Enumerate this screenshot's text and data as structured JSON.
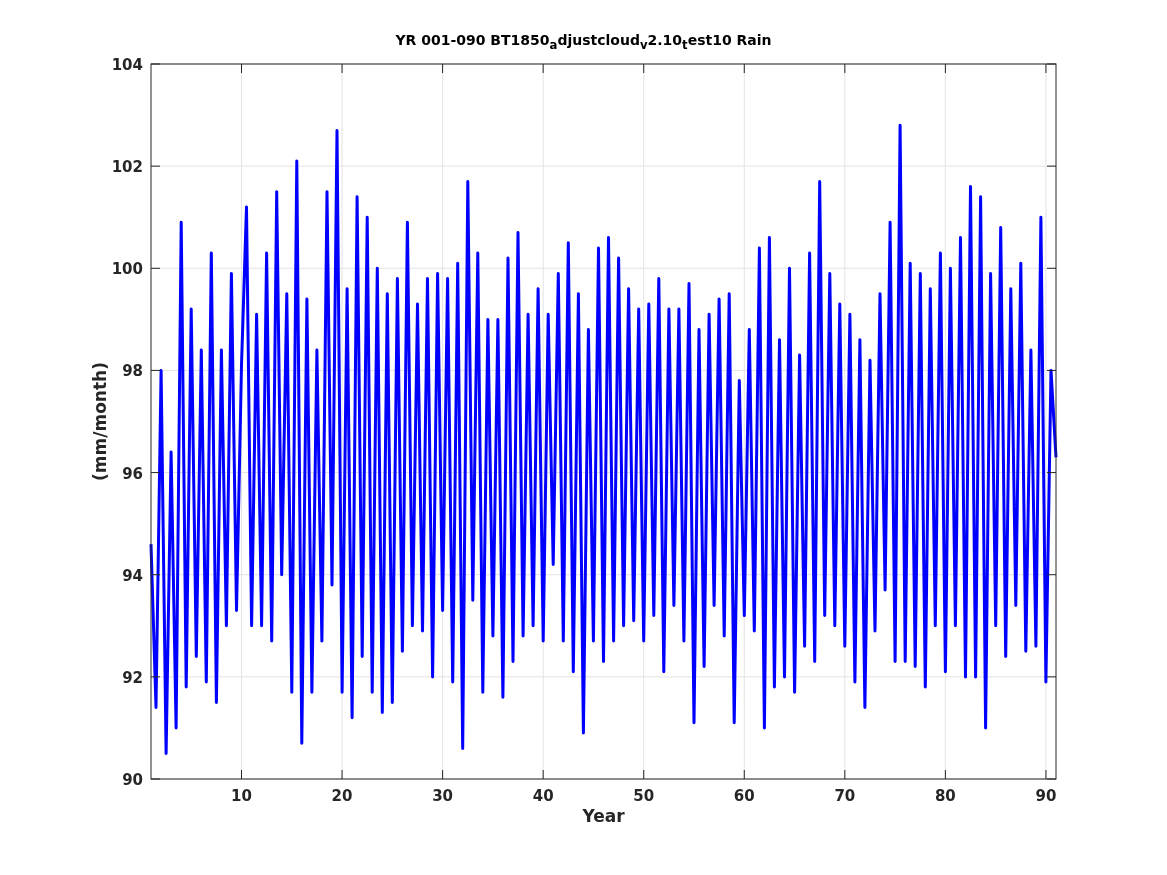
{
  "figure": {
    "chart_data": {
      "type": "line",
      "title": "YR 001-090 BT1850$_{a}$djustcloud$_{v}$2.10$_{t}$est10 Rain",
      "xlabel": "Year",
      "ylabel": "(mm/month)",
      "xlim": [
        1,
        91
      ],
      "ylim": [
        90,
        104
      ],
      "grid": true,
      "xticks": [
        10,
        20,
        30,
        40,
        50,
        60,
        70,
        80,
        90
      ],
      "yticks": [
        90,
        92,
        94,
        96,
        98,
        100,
        102,
        104
      ],
      "x": [
        1,
        1.5,
        2,
        2.5,
        3,
        3.5,
        4,
        4.5,
        5,
        5.5,
        6,
        6.5,
        7,
        7.5,
        8,
        8.5,
        9,
        9.5,
        10,
        10.5,
        11,
        11.5,
        12,
        12.5,
        13,
        13.5,
        14,
        14.5,
        15,
        15.5,
        16,
        16.5,
        17,
        17.5,
        18,
        18.5,
        19,
        19.5,
        20,
        20.5,
        21,
        21.5,
        22,
        22.5,
        23,
        23.5,
        24,
        24.5,
        25,
        25.5,
        26,
        26.5,
        27,
        27.5,
        28,
        28.5,
        29,
        29.5,
        30,
        30.5,
        31,
        31.5,
        32,
        32.5,
        33,
        33.5,
        34,
        34.5,
        35,
        35.5,
        36,
        36.5,
        37,
        37.5,
        38,
        38.5,
        39,
        39.5,
        40,
        40.5,
        41,
        41.5,
        42,
        42.5,
        43,
        43.5,
        44,
        44.5,
        45,
        45.5,
        46,
        46.5,
        47,
        47.5,
        48,
        48.5,
        49,
        49.5,
        50,
        50.5,
        51,
        51.5,
        52,
        52.5,
        53,
        53.5,
        54,
        54.5,
        55,
        55.5,
        56,
        56.5,
        57,
        57.5,
        58,
        58.5,
        59,
        59.5,
        60,
        60.5,
        61,
        61.5,
        62,
        62.5,
        63,
        63.5,
        64,
        64.5,
        65,
        65.5,
        66,
        66.5,
        67,
        67.5,
        68,
        68.5,
        69,
        69.5,
        70,
        70.5,
        71,
        71.5,
        72,
        72.5,
        73,
        73.5,
        74,
        74.5,
        75,
        75.5,
        76,
        76.5,
        77,
        77.5,
        78,
        78.5,
        79,
        79.5,
        80,
        80.5,
        81,
        81.5,
        82,
        82.5,
        83,
        83.5,
        84,
        84.5,
        85,
        85.5,
        86,
        86.5,
        87,
        87.5,
        88,
        88.5,
        89,
        89.5,
        90,
        90.5,
        91
      ],
      "series": [
        {
          "color": "#0000ff",
          "values": [
            94.6,
            91.4,
            98.0,
            90.5,
            96.4,
            91.0,
            100.9,
            91.8,
            99.2,
            92.4,
            98.4,
            91.9,
            100.3,
            91.5,
            98.4,
            93.0,
            99.9,
            93.3,
            98.1,
            101.2,
            93.0,
            99.1,
            93.0,
            100.3,
            92.7,
            101.5,
            94.0,
            99.5,
            91.7,
            102.1,
            90.7,
            99.4,
            91.7,
            98.4,
            92.7,
            101.5,
            93.8,
            102.7,
            91.7,
            99.6,
            91.2,
            101.4,
            92.4,
            101.0,
            91.7,
            100.0,
            91.3,
            99.5,
            91.5,
            99.8,
            92.5,
            100.9,
            93.0,
            99.3,
            92.9,
            99.8,
            92.0,
            99.9,
            93.3,
            99.8,
            91.9,
            100.1,
            90.6,
            101.7,
            93.5,
            100.3,
            91.7,
            99.0,
            92.8,
            99.0,
            91.6,
            100.2,
            92.3,
            100.7,
            92.8,
            99.1,
            93.0,
            99.6,
            92.7,
            99.1,
            94.2,
            99.9,
            92.7,
            100.5,
            92.1,
            99.5,
            90.9,
            98.8,
            92.7,
            100.4,
            92.3,
            100.6,
            92.7,
            100.2,
            93.0,
            99.6,
            93.1,
            99.2,
            92.7,
            99.3,
            93.2,
            99.8,
            92.1,
            99.2,
            93.4,
            99.2,
            92.7,
            99.7,
            91.1,
            98.8,
            92.2,
            99.1,
            93.4,
            99.4,
            92.8,
            99.5,
            91.1,
            97.8,
            93.2,
            98.8,
            92.9,
            100.4,
            91.0,
            100.6,
            91.8,
            98.6,
            92.0,
            100.0,
            91.7,
            98.3,
            92.6,
            100.3,
            92.3,
            101.7,
            93.2,
            99.9,
            93.0,
            99.3,
            92.6,
            99.1,
            91.9,
            98.6,
            91.4,
            98.2,
            92.9,
            99.5,
            93.7,
            100.9,
            92.3,
            102.8,
            92.3,
            100.1,
            92.2,
            99.9,
            91.8,
            99.6,
            93.0,
            100.3,
            92.1,
            100.0,
            93.0,
            100.6,
            92.0,
            101.6,
            92.0,
            101.4,
            91.0,
            99.9,
            93.0,
            100.8,
            92.4,
            99.6,
            93.4,
            100.1,
            92.5,
            98.4,
            92.6,
            101.0,
            91.9,
            98.0,
            96.3
          ]
        }
      ]
    }
  }
}
